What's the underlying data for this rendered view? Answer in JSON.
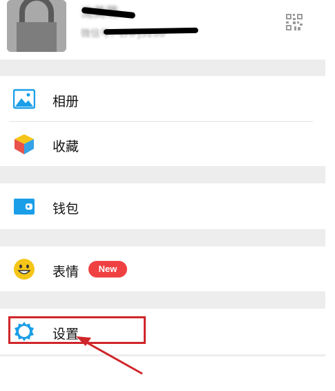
{
  "profile": {
    "name": "沈美萌",
    "wechat_id": "微信号：LHPJ5200",
    "avatar_icon": "lock-icon",
    "qr_icon": "qr-code-icon"
  },
  "menu": {
    "album": {
      "label": "相册",
      "icon": "album-icon",
      "color": "#1a9ee8"
    },
    "favorites": {
      "label": "收藏",
      "icon": "favorites-cube-icon"
    },
    "wallet": {
      "label": "钱包",
      "icon": "wallet-icon",
      "color": "#1a9ee8"
    },
    "stickers": {
      "label": "表情",
      "icon": "smiley-icon",
      "badge": "New",
      "badge_color": "#f04142"
    },
    "settings": {
      "label": "设置",
      "icon": "gear-icon",
      "color": "#1a9ee8"
    }
  },
  "annotation": {
    "color": "#d0262a"
  }
}
